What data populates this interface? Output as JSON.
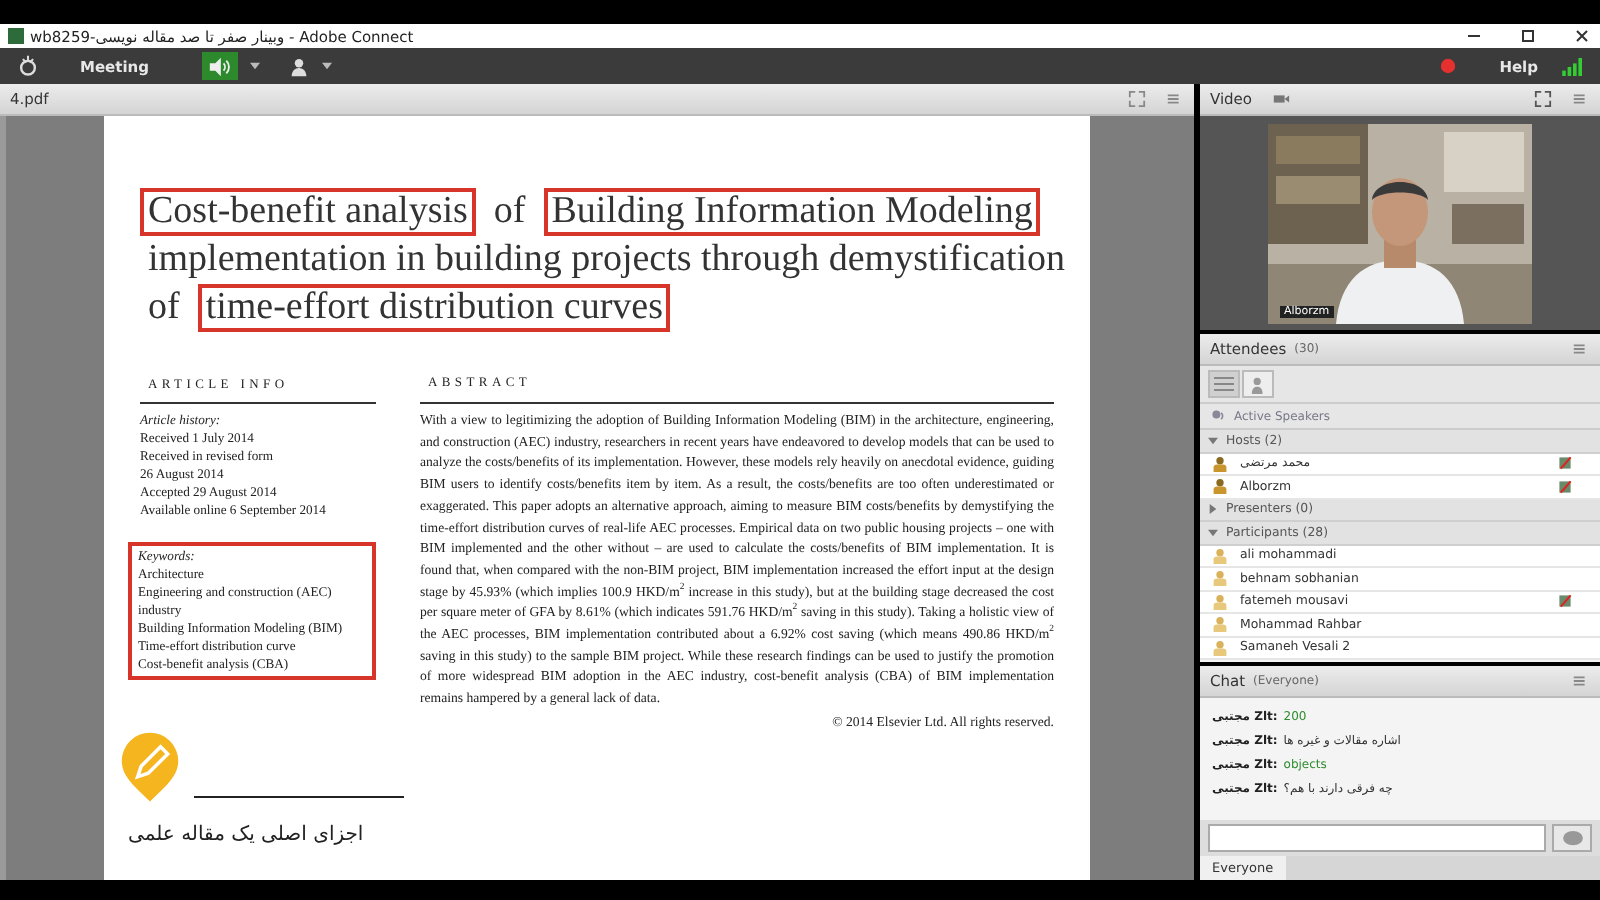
{
  "window": {
    "title": "wb8259-وبینار صفر تا صد مقاله نویسی - Adobe Connect"
  },
  "menubar": {
    "meeting": "Meeting",
    "help": "Help",
    "audio_on": true,
    "recording": true
  },
  "document": {
    "tab": "4.pdf",
    "title_lines": [
      [
        {
          "text": "Cost-benefit analysis",
          "highlighted": true
        },
        {
          "text": "of",
          "highlighted": false
        },
        {
          "text": "Building Information Modeling",
          "highlighted": true
        }
      ],
      [
        {
          "text": "implementation in building projects through demystification",
          "highlighted": false
        }
      ],
      [
        {
          "text": "of",
          "highlighted": false
        },
        {
          "text": "time-effort distribution curves",
          "highlighted": true
        }
      ]
    ],
    "article_info": {
      "heading": "ARTICLE INFO",
      "history_label": "Article history:",
      "history": [
        "Received 1 July 2014",
        "Received in revised form",
        "26 August 2014",
        "Accepted 29 August 2014",
        "Available online 6 September 2014"
      ],
      "keywords_label": "Keywords:",
      "keywords": [
        "Architecture",
        "Engineering and construction (AEC)",
        "industry",
        "Building Information Modeling (BIM)",
        "Time-effort distribution curve",
        "Cost-benefit analysis (CBA)"
      ],
      "keywords_highlighted": true
    },
    "abstract": {
      "heading": "ABSTRACT",
      "text": "With a view to legitimizing the adoption of Building Information Modeling (BIM) in the architecture, engineering, and construction (AEC) industry, researchers in recent years have endeavored to develop models that can be used to analyze the costs/benefits of its implementation. However, these models rely heavily on anecdotal evidence, guiding BIM users to identify costs/benefits item by item. As a result, the costs/benefits are too often underestimated or exaggerated. This paper adopts an alternative approach, aiming to measure BIM costs/benefits by demystifying the time-effort distribution curves of real-life AEC processes. Empirical data on two public housing projects – one with BIM implemented and the other without – are used to calculate the costs/benefits of BIM implementation. It is found that, when compared with the non-BIM project, BIM implementation increased the effort input at the design stage by 45.93% (which implies 100.9 HKD/m$^{2}$ increase in this study), but at the building stage decreased the cost per square meter of GFA by 8.61% (which indicates 591.76 HKD/m$^{2}$ saving in this study). Taking a holistic view of the AEC processes, BIM implementation contributed about a 6.92% cost saving (which means 490.86 HKD/m$^{2}$ saving in this study) to the sample BIM project. While these research findings can be used to justify the promotion of more widespread BIM adoption in the AEC industry, cost-benefit analysis (CBA) of BIM implementation remains hampered by a general lack of data.",
      "copyright": "© 2014 Elsevier Ltd. All rights reserved."
    }
  },
  "overlay": {
    "caption": "اجزای اصلی یک مقاله علمی"
  },
  "video": {
    "title": "Video",
    "name": "Alborzm"
  },
  "attendees": {
    "title": "Attendees",
    "count": "(30)",
    "active_speakers": "Active Speakers",
    "groups": [
      {
        "name": "Hosts (2)",
        "expanded": true,
        "people": [
          {
            "name": "محمد مرتضی",
            "kind": "host",
            "mic": true
          },
          {
            "name": "Alborzm",
            "kind": "host",
            "mic": true
          }
        ]
      },
      {
        "name": "Presenters (0)",
        "expanded": false
      },
      {
        "name": "Participants (28)",
        "expanded": true,
        "people": [
          {
            "name": "ali mohammadi",
            "kind": "participant",
            "mic": false
          },
          {
            "name": "behnam sobhanian",
            "kind": "participant",
            "mic": false
          },
          {
            "name": "fatemeh mousavi",
            "kind": "participant",
            "mic": true
          },
          {
            "name": "Mohammad Rahbar",
            "kind": "participant",
            "mic": false
          },
          {
            "name": "Samaneh Vesali 2",
            "kind": "participant",
            "mic": false
          }
        ]
      }
    ]
  },
  "chat": {
    "title": "Chat",
    "audience": "(Everyone)",
    "messages": [
      {
        "sender": "مجتبی Zlt:",
        "text": "200",
        "color": "#2e8b2e"
      },
      {
        "sender": "مجتبی Zlt:",
        "text": "اشاره مقالات و غیره ها",
        "color": "#333333"
      },
      {
        "sender": "مجتبی Zlt:",
        "text": "objects",
        "color": "#2e8b2e"
      },
      {
        "sender": "مجتبی Zlt:",
        "text": "چه فرقی دارند با هم؟",
        "color": "#333333"
      }
    ],
    "tab": "Everyone"
  }
}
